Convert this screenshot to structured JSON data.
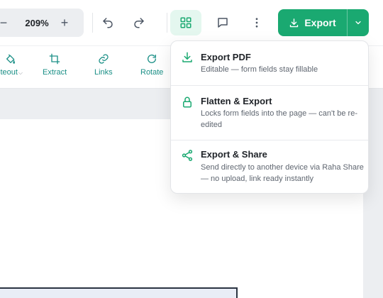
{
  "zoom": {
    "value": "209%",
    "minus": "−",
    "plus": "+"
  },
  "export_button": {
    "label": "Export"
  },
  "tools": [
    {
      "label": "iteout",
      "icon": "paint-bucket-icon"
    },
    {
      "label": "Extract",
      "icon": "crop-icon"
    },
    {
      "label": "Links",
      "icon": "link-icon"
    },
    {
      "label": "Rotate",
      "icon": "rotate-icon"
    }
  ],
  "export_menu": [
    {
      "title": "Export PDF",
      "description": "Editable — form fields stay fillable",
      "icon": "download-icon"
    },
    {
      "title": "Flatten & Export",
      "description": "Locks form fields into the page — can't be re-edited",
      "icon": "lock-icon"
    },
    {
      "title": "Export & Share",
      "description": "Send directly to another device via Raha Share — no upload, link ready instantly",
      "icon": "share-icon"
    }
  ],
  "colors": {
    "accent": "#1aa971",
    "tool_text": "#1a8f86"
  }
}
